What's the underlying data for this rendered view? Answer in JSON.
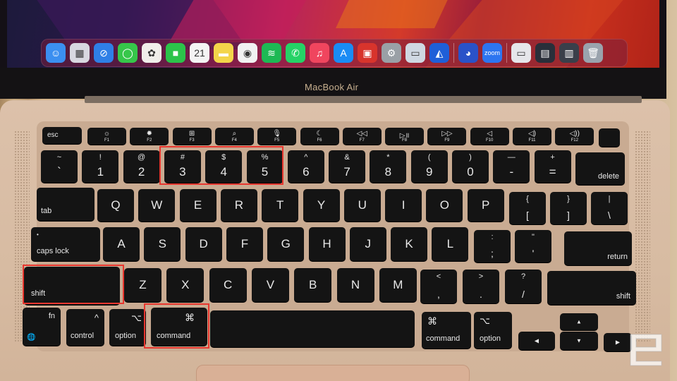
{
  "brand_label": "MacBook Air",
  "dock": {
    "apps": [
      {
        "name": "finder",
        "glyph": "☺",
        "color": "#3b8ff0"
      },
      {
        "name": "launchpad",
        "glyph": "▦",
        "color": "#d8d8e0"
      },
      {
        "name": "safari",
        "glyph": "⊘",
        "color": "#2f7fe6"
      },
      {
        "name": "messages",
        "glyph": "◯",
        "color": "#36c74a"
      },
      {
        "name": "photos",
        "glyph": "✿",
        "color": "#f0eeea"
      },
      {
        "name": "facetime",
        "glyph": "■",
        "color": "#2cc34a"
      },
      {
        "name": "calendar",
        "glyph": "21",
        "color": "#f4f4f4"
      },
      {
        "name": "notes",
        "glyph": "▬",
        "color": "#f3d54a"
      },
      {
        "name": "chrome",
        "glyph": "◉",
        "color": "#f1f1f1"
      },
      {
        "name": "spotify",
        "glyph": "≋",
        "color": "#1db954"
      },
      {
        "name": "whatsapp",
        "glyph": "✆",
        "color": "#25d366"
      },
      {
        "name": "music",
        "glyph": "♫",
        "color": "#f0455e"
      },
      {
        "name": "app-store",
        "glyph": "A",
        "color": "#1a8cf5"
      },
      {
        "name": "photo-booth",
        "glyph": "▣",
        "color": "#d8342c"
      },
      {
        "name": "system-preferences",
        "glyph": "⚙",
        "color": "#9aa0a6"
      },
      {
        "name": "preview",
        "glyph": "▭",
        "color": "#cfd8e2"
      },
      {
        "name": "game-controller",
        "glyph": "◭",
        "color": "#1f5fd8"
      },
      {
        "name": "podcast-app",
        "glyph": "◕",
        "color": "#2a52c8"
      },
      {
        "name": "zoom",
        "glyph": "zoom",
        "color": "#2d75f0"
      },
      {
        "name": "window-preview-1",
        "glyph": "▭",
        "color": "#e6e6ea"
      },
      {
        "name": "window-preview-2",
        "glyph": "▤",
        "color": "#2a2f3a"
      },
      {
        "name": "window-preview-3",
        "glyph": "▥",
        "color": "#3a3f4a"
      },
      {
        "name": "trash",
        "glyph": "🗑",
        "color": "#9aa3ad"
      }
    ]
  },
  "keys": {
    "esc": "esc",
    "fnrow": [
      {
        "icon": "☼",
        "label": "F1"
      },
      {
        "icon": "✹",
        "label": "F2"
      },
      {
        "icon": "⊞",
        "label": "F3"
      },
      {
        "icon": "⌕",
        "label": "F4"
      },
      {
        "icon": "🎙",
        "label": "F5"
      },
      {
        "icon": "☾",
        "label": "F6"
      },
      {
        "icon": "◁◁",
        "label": "F7"
      },
      {
        "icon": "▷॥",
        "label": "F8"
      },
      {
        "icon": "▷▷",
        "label": "F9"
      },
      {
        "icon": "◁",
        "label": "F10"
      },
      {
        "icon": "◁)",
        "label": "F11"
      },
      {
        "icon": "◁))",
        "label": "F12"
      }
    ],
    "numrow": [
      {
        "u": "~",
        "d": "`"
      },
      {
        "u": "!",
        "d": "1"
      },
      {
        "u": "@",
        "d": "2"
      },
      {
        "u": "#",
        "d": "3"
      },
      {
        "u": "$",
        "d": "4"
      },
      {
        "u": "%",
        "d": "5"
      },
      {
        "u": "^",
        "d": "6"
      },
      {
        "u": "&",
        "d": "7"
      },
      {
        "u": "*",
        "d": "8"
      },
      {
        "u": "(",
        "d": "9"
      },
      {
        "u": ")",
        "d": "0"
      },
      {
        "u": "—",
        "d": "-"
      },
      {
        "u": "+",
        "d": "="
      }
    ],
    "delete": "delete",
    "tab": "tab",
    "qrow": [
      "Q",
      "W",
      "E",
      "R",
      "T",
      "Y",
      "U",
      "I",
      "O",
      "P"
    ],
    "brackets": [
      {
        "u": "{",
        "d": "["
      },
      {
        "u": "}",
        "d": "]"
      },
      {
        "u": "|",
        "d": "\\"
      }
    ],
    "caps": "caps lock",
    "arow": [
      "A",
      "S",
      "D",
      "F",
      "G",
      "H",
      "J",
      "K",
      "L"
    ],
    "semi": [
      {
        "u": ":",
        "d": ";"
      },
      {
        "u": "\"",
        "d": "'"
      }
    ],
    "return": "return",
    "shift": "shift",
    "zrow": [
      "Z",
      "X",
      "C",
      "V",
      "B",
      "N",
      "M"
    ],
    "punct": [
      {
        "u": "<",
        "d": ","
      },
      {
        "u": ">",
        "d": "."
      },
      {
        "u": "?",
        "d": "/"
      }
    ],
    "fn": "fn",
    "globe": "🌐",
    "control": "control",
    "control_sym": "^",
    "option": "option",
    "option_sym": "⌥",
    "command": "command",
    "command_sym": "⌘",
    "arrows": {
      "up": "▲",
      "down": "▼",
      "left": "◀",
      "right": "▶"
    }
  },
  "highlights": [
    "3",
    "4",
    "5",
    "shift",
    "command"
  ]
}
